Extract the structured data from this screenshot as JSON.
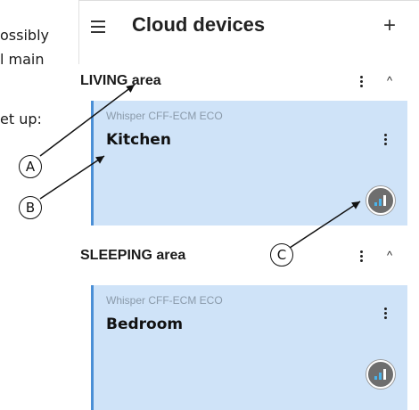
{
  "manual": {
    "line1": "ossibly",
    "line2": "l main",
    "line3": "et up:"
  },
  "header": {
    "menu_icon": "menu-icon",
    "title": "Cloud devices",
    "add_label": "+"
  },
  "sections": [
    {
      "title": "LIVING area",
      "caret": "^",
      "card": {
        "model": "Whisper CFF-ECM ECO",
        "name": "Kitchen"
      }
    },
    {
      "title": "SLEEPING area",
      "caret": "^",
      "card": {
        "model": "Whisper CFF-ECM ECO",
        "name": "Bedroom"
      }
    }
  ],
  "callouts": {
    "a": "A",
    "b": "B",
    "c": "C"
  },
  "colors": {
    "card_bg": "#cfe3f8",
    "card_accent": "#4a8fd6",
    "signal_bars": "#4ab3ea"
  }
}
